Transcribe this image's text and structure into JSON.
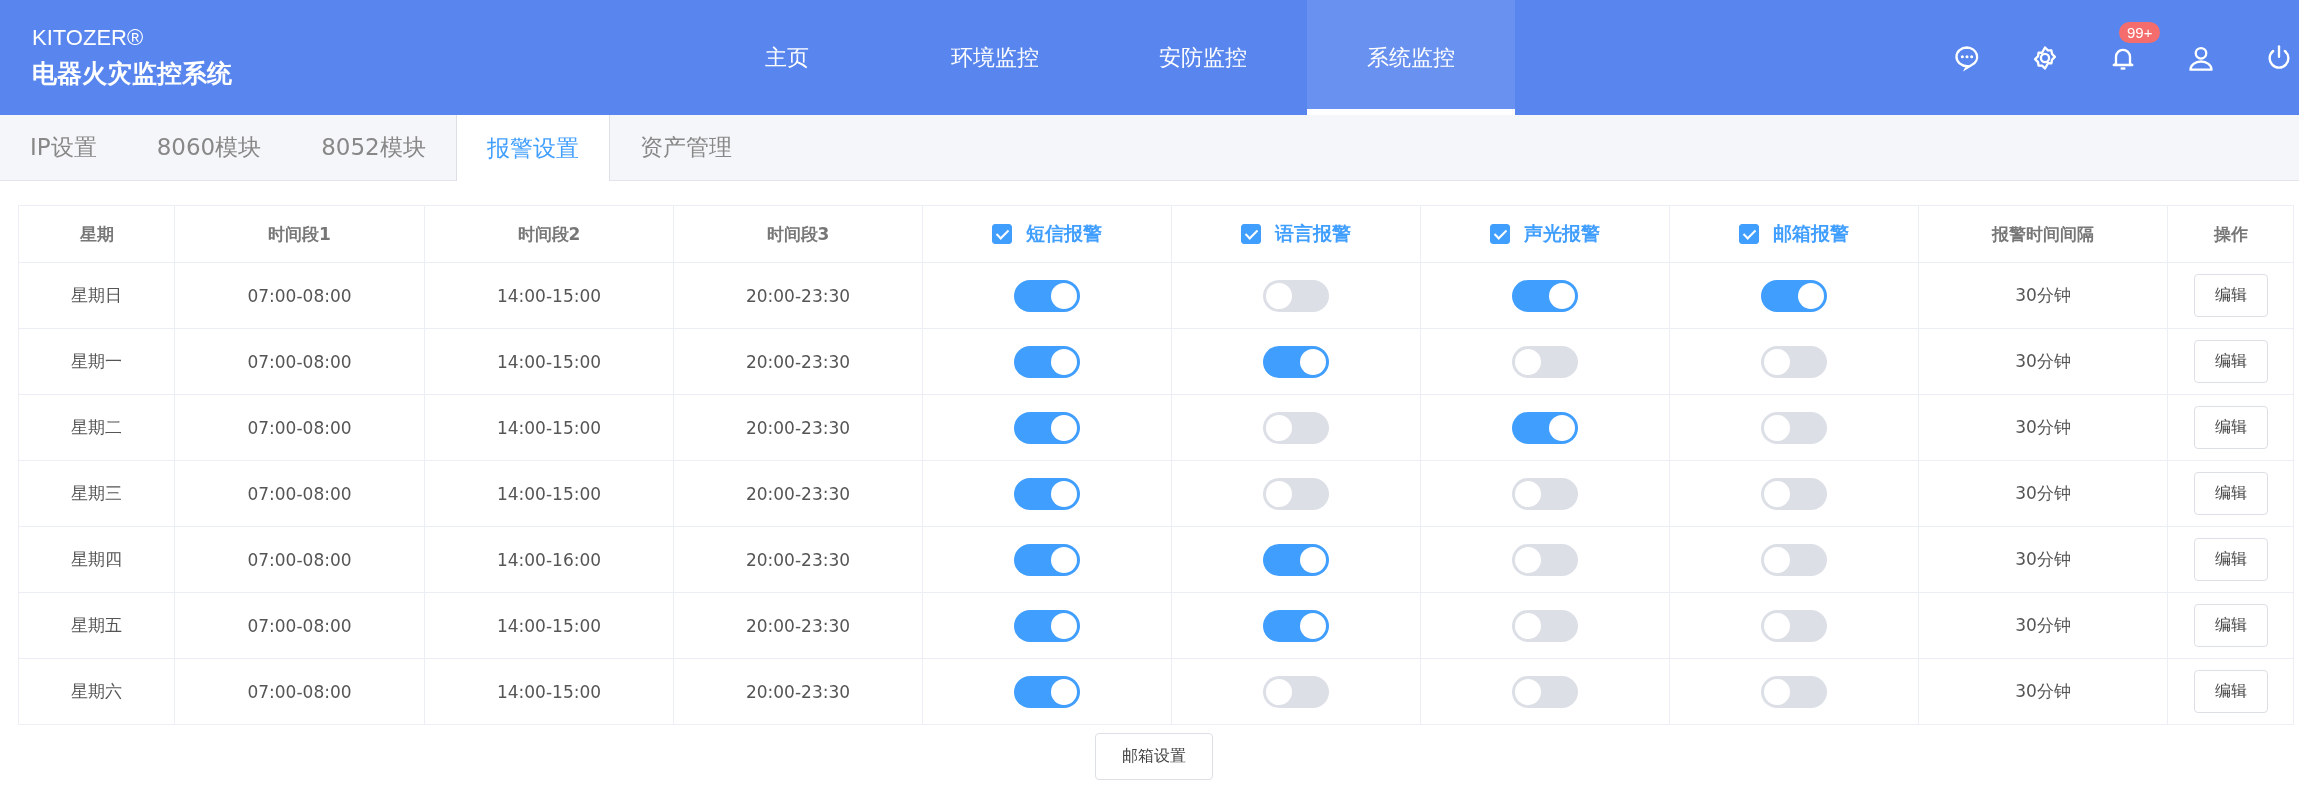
{
  "header": {
    "brand": "KITOZER®",
    "title": "电器火灾监控系统",
    "nav": [
      {
        "label": "主页",
        "selected": false
      },
      {
        "label": "环境监控",
        "selected": false
      },
      {
        "label": "安防监控",
        "selected": false
      },
      {
        "label": "系统监控",
        "selected": true
      }
    ],
    "notification_badge": "99+"
  },
  "tabs": [
    {
      "label": "IP设置",
      "selected": false
    },
    {
      "label": "8060模块",
      "selected": false
    },
    {
      "label": "8052模块",
      "selected": false
    },
    {
      "label": "报警设置",
      "selected": true
    },
    {
      "label": "资产管理",
      "selected": false
    }
  ],
  "table": {
    "columns": [
      {
        "label": "星期"
      },
      {
        "label": "时间段1"
      },
      {
        "label": "时间段2"
      },
      {
        "label": "时间段3"
      },
      {
        "label": "短信报警",
        "checked": true
      },
      {
        "label": "语言报警",
        "checked": true
      },
      {
        "label": "声光报警",
        "checked": true
      },
      {
        "label": "邮箱报警",
        "checked": true
      },
      {
        "label": "报警时间间隔"
      },
      {
        "label": "操作"
      }
    ],
    "rows": [
      {
        "day": "星期日",
        "t1": "07:00-08:00",
        "t2": "14:00-15:00",
        "t3": "20:00-23:30",
        "switches": [
          true,
          false,
          true,
          true
        ],
        "interval": "30分钟",
        "action": "编辑"
      },
      {
        "day": "星期一",
        "t1": "07:00-08:00",
        "t2": "14:00-15:00",
        "t3": "20:00-23:30",
        "switches": [
          true,
          true,
          false,
          false
        ],
        "interval": "30分钟",
        "action": "编辑"
      },
      {
        "day": "星期二",
        "t1": "07:00-08:00",
        "t2": "14:00-15:00",
        "t3": "20:00-23:30",
        "switches": [
          true,
          false,
          true,
          false
        ],
        "interval": "30分钟",
        "action": "编辑"
      },
      {
        "day": "星期三",
        "t1": "07:00-08:00",
        "t2": "14:00-15:00",
        "t3": "20:00-23:30",
        "switches": [
          true,
          false,
          false,
          false
        ],
        "interval": "30分钟",
        "action": "编辑"
      },
      {
        "day": "星期四",
        "t1": "07:00-08:00",
        "t2": "14:00-16:00",
        "t3": "20:00-23:30",
        "switches": [
          true,
          true,
          false,
          false
        ],
        "interval": "30分钟",
        "action": "编辑"
      },
      {
        "day": "星期五",
        "t1": "07:00-08:00",
        "t2": "14:00-15:00",
        "t3": "20:00-23:30",
        "switches": [
          true,
          true,
          false,
          false
        ],
        "interval": "30分钟",
        "action": "编辑"
      },
      {
        "day": "星期六",
        "t1": "07:00-08:00",
        "t2": "14:00-15:00",
        "t3": "20:00-23:30",
        "switches": [
          true,
          false,
          false,
          false
        ],
        "interval": "30分钟",
        "action": "编辑"
      }
    ]
  },
  "footer_button": "邮箱设置"
}
